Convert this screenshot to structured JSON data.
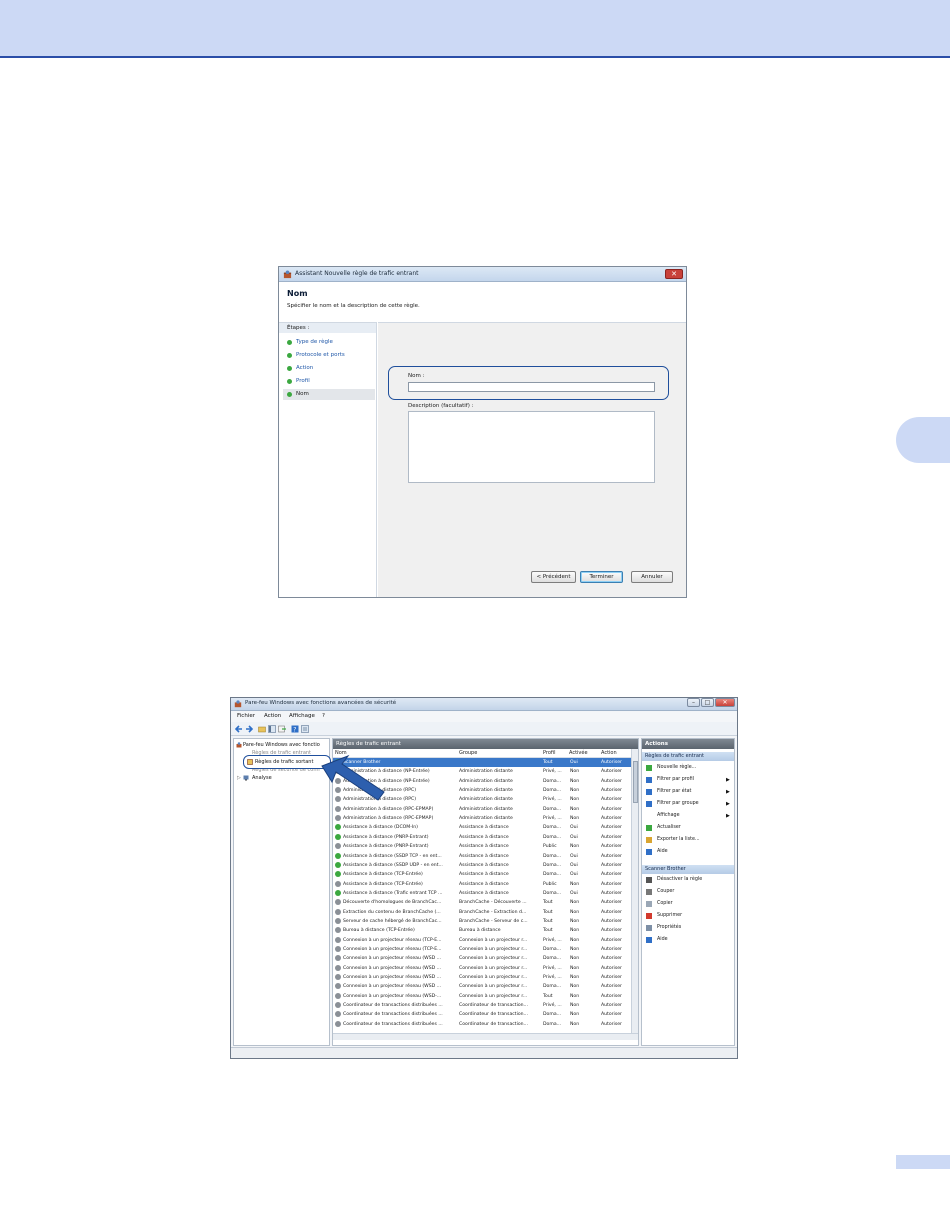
{
  "page": {
    "accent_color": "#ccd9f5",
    "rule_color": "#2a4ea8"
  },
  "wizard": {
    "title": "Assistant Nouvelle règle de trafic entrant",
    "close": "✕",
    "heading": "Nom",
    "subtitle": "Spécifier le nom et la description de cette règle.",
    "steps_title": "Étapes :",
    "steps": [
      {
        "label": "Type de règle"
      },
      {
        "label": "Protocole et ports"
      },
      {
        "label": "Action"
      },
      {
        "label": "Profil"
      },
      {
        "label": "Nom"
      }
    ],
    "name_label": "Nom :",
    "name_value": "",
    "description_label": "Description (facultatif) :",
    "description_value": "",
    "buttons": {
      "back": "< Précédent",
      "finish": "Terminer",
      "cancel": "Annuler"
    }
  },
  "console": {
    "title": "Pare-feu Windows avec fonctions avancées de sécurité",
    "window_buttons": {
      "min": "–",
      "max": "□",
      "close": "✕"
    },
    "menu": [
      "Fichier",
      "Action",
      "Affichage",
      "?"
    ],
    "tree": [
      "Pare-feu Windows avec fonctio",
      "Règles de trafic entrant",
      "Règles de trafic sortant",
      "Règles de sécurité de conn",
      "Analyse"
    ],
    "center_title": "Règles de trafic entrant",
    "columns": [
      "Nom",
      "Groupe",
      "Profil",
      "Activée",
      "Action"
    ],
    "rows": [
      {
        "nom": "Scanner Brother",
        "groupe": "",
        "profil": "Tout",
        "activee": "Oui",
        "action": "Autoriser",
        "state": "allow",
        "selected": true
      },
      {
        "nom": "Administration à distance (NP-Entrée)",
        "groupe": "Administration distante",
        "profil": "Privé, ...",
        "activee": "Non",
        "action": "Autoriser",
        "state": "off"
      },
      {
        "nom": "Administration à distance (NP-Entrée)",
        "groupe": "Administration distante",
        "profil": "Doma...",
        "activee": "Non",
        "action": "Autoriser",
        "state": "off"
      },
      {
        "nom": "Administration à distance (RPC)",
        "groupe": "Administration distante",
        "profil": "Doma...",
        "activee": "Non",
        "action": "Autoriser",
        "state": "off"
      },
      {
        "nom": "Administration à distance (RPC)",
        "groupe": "Administration distante",
        "profil": "Privé, ...",
        "activee": "Non",
        "action": "Autoriser",
        "state": "off"
      },
      {
        "nom": "Administration à distance (RPC-EPMAP)",
        "groupe": "Administration distante",
        "profil": "Doma...",
        "activee": "Non",
        "action": "Autoriser",
        "state": "off"
      },
      {
        "nom": "Administration à distance (RPC-EPMAP)",
        "groupe": "Administration distante",
        "profil": "Privé, ...",
        "activee": "Non",
        "action": "Autoriser",
        "state": "off"
      },
      {
        "nom": "Assistance à distance (DCOM-In)",
        "groupe": "Assistance à distance",
        "profil": "Doma...",
        "activee": "Oui",
        "action": "Autoriser",
        "state": "allow"
      },
      {
        "nom": "Assistance à distance (PNRP-Entrant)",
        "groupe": "Assistance à distance",
        "profil": "Doma...",
        "activee": "Oui",
        "action": "Autoriser",
        "state": "allow"
      },
      {
        "nom": "Assistance à distance (PNRP-Entrant)",
        "groupe": "Assistance à distance",
        "profil": "Public",
        "activee": "Non",
        "action": "Autoriser",
        "state": "off"
      },
      {
        "nom": "Assistance à distance (SSDP TCP - en ent...",
        "groupe": "Assistance à distance",
        "profil": "Doma...",
        "activee": "Oui",
        "action": "Autoriser",
        "state": "allow"
      },
      {
        "nom": "Assistance à distance (SSDP UDP - en ent...",
        "groupe": "Assistance à distance",
        "profil": "Doma...",
        "activee": "Oui",
        "action": "Autoriser",
        "state": "allow"
      },
      {
        "nom": "Assistance à distance (TCP-Entrée)",
        "groupe": "Assistance à distance",
        "profil": "Doma...",
        "activee": "Oui",
        "action": "Autoriser",
        "state": "allow"
      },
      {
        "nom": "Assistance à distance (TCP-Entrée)",
        "groupe": "Assistance à distance",
        "profil": "Public",
        "activee": "Non",
        "action": "Autoriser",
        "state": "off"
      },
      {
        "nom": "Assistance à distance (Trafic entrant TCP ...",
        "groupe": "Assistance à distance",
        "profil": "Doma...",
        "activee": "Oui",
        "action": "Autoriser",
        "state": "allow"
      },
      {
        "nom": "Découverte d'homologues de BranchCac...",
        "groupe": "BranchCache - Découverte ...",
        "profil": "Tout",
        "activee": "Non",
        "action": "Autoriser",
        "state": "off"
      },
      {
        "nom": "Extraction du contenu de BranchCache (...",
        "groupe": "BranchCache - Extraction d...",
        "profil": "Tout",
        "activee": "Non",
        "action": "Autoriser",
        "state": "off"
      },
      {
        "nom": "Serveur de cache hébergé de BranchCac...",
        "groupe": "BranchCache - Serveur de c...",
        "profil": "Tout",
        "activee": "Non",
        "action": "Autoriser",
        "state": "off"
      },
      {
        "nom": "Bureau à distance (TCP-Entrée)",
        "groupe": "Bureau à distance",
        "profil": "Tout",
        "activee": "Non",
        "action": "Autoriser",
        "state": "off"
      },
      {
        "nom": "Connexion à un projecteur réseau (TCP-E...",
        "groupe": "Connexion à un projecteur r...",
        "profil": "Privé, ...",
        "activee": "Non",
        "action": "Autoriser",
        "state": "off"
      },
      {
        "nom": "Connexion à un projecteur réseau (TCP-E...",
        "groupe": "Connexion à un projecteur r...",
        "profil": "Doma...",
        "activee": "Non",
        "action": "Autoriser",
        "state": "off"
      },
      {
        "nom": "Connexion à un projecteur réseau (WSD ...",
        "groupe": "Connexion à un projecteur r...",
        "profil": "Doma...",
        "activee": "Non",
        "action": "Autoriser",
        "state": "off"
      },
      {
        "nom": "Connexion à un projecteur réseau (WSD ...",
        "groupe": "Connexion à un projecteur r...",
        "profil": "Privé, ...",
        "activee": "Non",
        "action": "Autoriser",
        "state": "off"
      },
      {
        "nom": "Connexion à un projecteur réseau (WSD ...",
        "groupe": "Connexion à un projecteur r...",
        "profil": "Privé, ...",
        "activee": "Non",
        "action": "Autoriser",
        "state": "off"
      },
      {
        "nom": "Connexion à un projecteur réseau (WSD ...",
        "groupe": "Connexion à un projecteur r...",
        "profil": "Doma...",
        "activee": "Non",
        "action": "Autoriser",
        "state": "off"
      },
      {
        "nom": "Connexion à un projecteur réseau (WSD-...",
        "groupe": "Connexion à un projecteur r...",
        "profil": "Tout",
        "activee": "Non",
        "action": "Autoriser",
        "state": "off"
      },
      {
        "nom": "Coordinateur de transactions distribuées ...",
        "groupe": "Coordinateur de transaction...",
        "profil": "Privé, ...",
        "activee": "Non",
        "action": "Autoriser",
        "state": "off"
      },
      {
        "nom": "Coordinateur de transactions distribuées ...",
        "groupe": "Coordinateur de transaction...",
        "profil": "Doma...",
        "activee": "Non",
        "action": "Autoriser",
        "state": "off"
      },
      {
        "nom": "Coordinateur de transactions distribuées ...",
        "groupe": "Coordinateur de transaction...",
        "profil": "Doma...",
        "activee": "Non",
        "action": "Autoriser",
        "state": "off"
      }
    ],
    "actions_title": "Actions",
    "section1": "Règles de trafic entrant",
    "section1_items": [
      {
        "label": "Nouvelle règle...",
        "icon": "new-rule-icon",
        "sub": false
      },
      {
        "label": "Filtrer par profil",
        "icon": "filter-icon",
        "sub": true
      },
      {
        "label": "Filtrer par état",
        "icon": "filter-icon",
        "sub": true
      },
      {
        "label": "Filtrer par groupe",
        "icon": "filter-icon",
        "sub": true
      },
      {
        "label": "Affichage",
        "icon": "",
        "sub": true
      },
      {
        "label": "Actualiser",
        "icon": "refresh-icon",
        "sub": false
      },
      {
        "label": "Exporter la liste...",
        "icon": "export-icon",
        "sub": false
      },
      {
        "label": "Aide",
        "icon": "help-icon",
        "sub": false
      }
    ],
    "section2": "Scanner Brother",
    "section2_items": [
      {
        "label": "Désactiver la règle",
        "icon": "disable-icon"
      },
      {
        "label": "Couper",
        "icon": "cut-icon"
      },
      {
        "label": "Copier",
        "icon": "copy-icon"
      },
      {
        "label": "Supprimer",
        "icon": "delete-icon"
      },
      {
        "label": "Propriétés",
        "icon": "properties-icon"
      },
      {
        "label": "Aide",
        "icon": "help-icon"
      }
    ],
    "colors": {
      "allow": "#3ba840",
      "off": "#8a8f96",
      "selected": "#3a78c9",
      "highlight": "#1f4f9c"
    }
  }
}
